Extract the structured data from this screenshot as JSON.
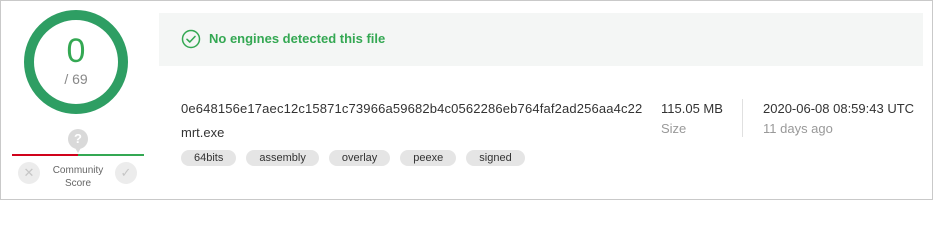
{
  "score": {
    "detected": "0",
    "total": "/ 69",
    "ring_color": "#34a853"
  },
  "community": {
    "label_line1": "Community",
    "label_line2": "Score",
    "unknown_glyph": "?",
    "vote_down_glyph": "✕",
    "vote_up_glyph": "✓"
  },
  "banner": {
    "text": "No engines detected this file",
    "icon": "check-circle-icon",
    "color": "#34a853"
  },
  "file": {
    "hash": "0e648156e17aec12c15871c73966a59682b4c0562286eb764faf2ad256aa4c22",
    "name": "mrt.exe",
    "tags": [
      "64bits",
      "assembly",
      "overlay",
      "peexe",
      "signed"
    ]
  },
  "size": {
    "value": "115.05 MB",
    "label": "Size"
  },
  "date": {
    "value": "2020-06-08 08:59:43 UTC",
    "relative": "11 days ago"
  }
}
